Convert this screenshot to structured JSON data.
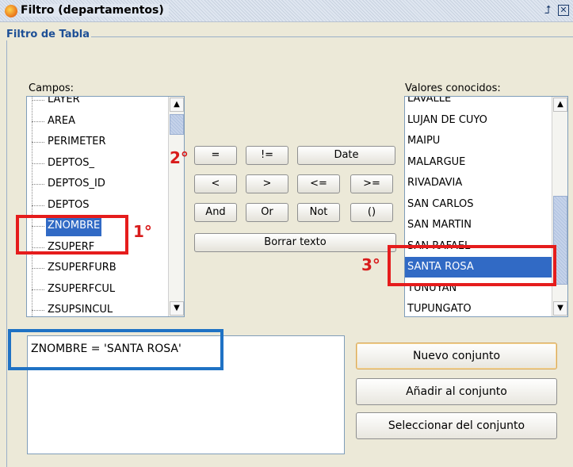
{
  "window": {
    "title": "Filtro (departamentos)"
  },
  "panel": {
    "title": "Filtro de Tabla"
  },
  "fields": {
    "label": "Campos:",
    "items": [
      {
        "label": "LAYER",
        "selected": false
      },
      {
        "label": "AREA",
        "selected": false
      },
      {
        "label": "PERIMETER",
        "selected": false
      },
      {
        "label": "DEPTOS_",
        "selected": false
      },
      {
        "label": "DEPTOS_ID",
        "selected": false
      },
      {
        "label": "DEPTOS",
        "selected": false
      },
      {
        "label": "ZNOMBRE",
        "selected": true
      },
      {
        "label": "ZSUPERF",
        "selected": false
      },
      {
        "label": "ZSUPERFURB",
        "selected": false
      },
      {
        "label": "ZSUPERFCUL",
        "selected": false
      },
      {
        "label": "ZSUPSINCUL",
        "selected": false
      }
    ]
  },
  "values": {
    "label": "Valores conocidos:",
    "items": [
      {
        "label": "LAVALLE",
        "selected": false
      },
      {
        "label": "LUJAN DE CUYO",
        "selected": false
      },
      {
        "label": "MAIPU",
        "selected": false
      },
      {
        "label": "MALARGUE",
        "selected": false
      },
      {
        "label": "RIVADAVIA",
        "selected": false
      },
      {
        "label": "SAN CARLOS",
        "selected": false
      },
      {
        "label": "SAN MARTIN",
        "selected": false
      },
      {
        "label": "SAN RAFAEL",
        "selected": false
      },
      {
        "label": "SANTA ROSA",
        "selected": true
      },
      {
        "label": "TUNUYAN",
        "selected": false
      },
      {
        "label": "TUPUNGATO",
        "selected": false
      }
    ]
  },
  "operators": {
    "eq": "=",
    "neq": "!=",
    "date": "Date",
    "lt": "<",
    "gt": ">",
    "le": "<=",
    "ge": ">=",
    "and": "And",
    "or": "Or",
    "not": "Not",
    "paren": "()",
    "clear": "Borrar texto"
  },
  "expression": {
    "value": "ZNOMBRE = 'SANTA ROSA'"
  },
  "actions": {
    "new_set": "Nuevo conjunto",
    "add_to_set": "Añadir al conjunto",
    "select_from_set": "Seleccionar del conjunto"
  },
  "annotations": {
    "step1": "1°",
    "step2": "2°",
    "step3": "3°"
  },
  "colors": {
    "highlight_red": "#e51c1c",
    "highlight_blue": "#1f72c4",
    "selection": "#316ac5",
    "panel_title": "#1d4f96"
  },
  "icons": {
    "app": "gvsig-app-icon",
    "dock": "dock-icon",
    "close": "close-icon"
  }
}
